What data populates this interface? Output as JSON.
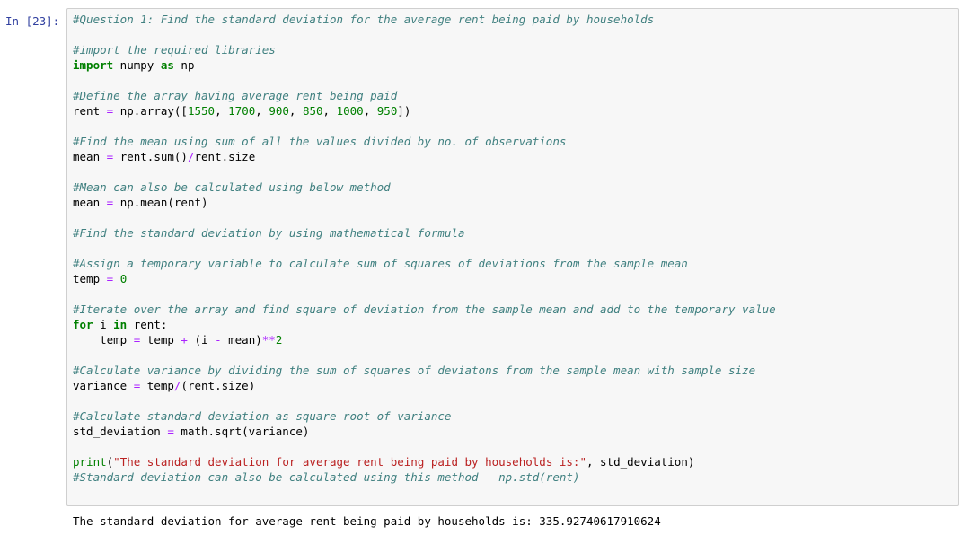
{
  "cell": {
    "prompt": "In [23]:",
    "lines": [
      [
        {
          "t": "#Question 1: Find the standard deviation for the average rent being paid by households",
          "c": "cm"
        }
      ],
      [],
      [
        {
          "t": "#import the required libraries",
          "c": "cm"
        }
      ],
      [
        {
          "t": "import",
          "c": "kw"
        },
        {
          "t": " numpy ",
          "c": ""
        },
        {
          "t": "as",
          "c": "kw"
        },
        {
          "t": " np",
          "c": ""
        }
      ],
      [],
      [
        {
          "t": "#Define the array having average rent being paid",
          "c": "cm"
        }
      ],
      [
        {
          "t": "rent ",
          "c": ""
        },
        {
          "t": "=",
          "c": "op"
        },
        {
          "t": " np.array([",
          "c": ""
        },
        {
          "t": "1550",
          "c": "num"
        },
        {
          "t": ", ",
          "c": ""
        },
        {
          "t": "1700",
          "c": "num"
        },
        {
          "t": ", ",
          "c": ""
        },
        {
          "t": "900",
          "c": "num"
        },
        {
          "t": ", ",
          "c": ""
        },
        {
          "t": "850",
          "c": "num"
        },
        {
          "t": ", ",
          "c": ""
        },
        {
          "t": "1000",
          "c": "num"
        },
        {
          "t": ", ",
          "c": ""
        },
        {
          "t": "950",
          "c": "num"
        },
        {
          "t": "])",
          "c": ""
        }
      ],
      [],
      [
        {
          "t": "#Find the mean using sum of all the values divided by no. of observations",
          "c": "cm"
        }
      ],
      [
        {
          "t": "mean ",
          "c": ""
        },
        {
          "t": "=",
          "c": "op"
        },
        {
          "t": " rent.sum()",
          "c": ""
        },
        {
          "t": "/",
          "c": "op"
        },
        {
          "t": "rent.size",
          "c": ""
        }
      ],
      [],
      [
        {
          "t": "#Mean can also be calculated using below method",
          "c": "cm"
        }
      ],
      [
        {
          "t": "mean ",
          "c": ""
        },
        {
          "t": "=",
          "c": "op"
        },
        {
          "t": " np.mean(rent)",
          "c": ""
        }
      ],
      [],
      [
        {
          "t": "#Find the standard deviation by using mathematical formula",
          "c": "cm"
        }
      ],
      [],
      [
        {
          "t": "#Assign a temporary variable to calculate sum of squares of deviations from the sample mean",
          "c": "cm"
        }
      ],
      [
        {
          "t": "temp ",
          "c": ""
        },
        {
          "t": "=",
          "c": "op"
        },
        {
          "t": " ",
          "c": ""
        },
        {
          "t": "0",
          "c": "num"
        }
      ],
      [],
      [
        {
          "t": "#Iterate over the array and find square of deviation from the sample mean and add to the temporary value",
          "c": "cm"
        }
      ],
      [
        {
          "t": "for",
          "c": "kw"
        },
        {
          "t": " i ",
          "c": ""
        },
        {
          "t": "in",
          "c": "kw"
        },
        {
          "t": " rent:",
          "c": ""
        }
      ],
      [
        {
          "t": "    temp ",
          "c": ""
        },
        {
          "t": "=",
          "c": "op"
        },
        {
          "t": " temp ",
          "c": ""
        },
        {
          "t": "+",
          "c": "op"
        },
        {
          "t": " (i ",
          "c": ""
        },
        {
          "t": "-",
          "c": "op"
        },
        {
          "t": " mean)",
          "c": ""
        },
        {
          "t": "**",
          "c": "op"
        },
        {
          "t": "2",
          "c": "num"
        }
      ],
      [],
      [
        {
          "t": "#Calculate variance by dividing the sum of squares of deviatons from the sample mean with sample size",
          "c": "cm"
        }
      ],
      [
        {
          "t": "variance ",
          "c": ""
        },
        {
          "t": "=",
          "c": "op"
        },
        {
          "t": " temp",
          "c": ""
        },
        {
          "t": "/",
          "c": "op"
        },
        {
          "t": "(rent.size)",
          "c": ""
        }
      ],
      [],
      [
        {
          "t": "#Calculate standard deviation as square root of variance",
          "c": "cm"
        }
      ],
      [
        {
          "t": "std_deviation ",
          "c": ""
        },
        {
          "t": "=",
          "c": "op"
        },
        {
          "t": " math.sqrt(variance)",
          "c": ""
        }
      ],
      [],
      [
        {
          "t": "print",
          "c": "kw2"
        },
        {
          "t": "(",
          "c": ""
        },
        {
          "t": "\"The standard deviation for average rent being paid by households is:\"",
          "c": "str"
        },
        {
          "t": ", std_deviation)",
          "c": ""
        }
      ],
      [
        {
          "t": "#Standard deviation can also be calculated using this method - np.std(rent)",
          "c": "cm"
        }
      ]
    ],
    "output": "The standard deviation for average rent being paid by households is: 335.92740617910624"
  },
  "colors": {
    "comment": "#408080",
    "keyword": "#008000",
    "number": "#008000",
    "operator": "#aa22ff",
    "string": "#ba2121",
    "prompt": "#303f9f",
    "cell_background": "#f7f7f7",
    "cell_border": "#cfcfcf"
  }
}
